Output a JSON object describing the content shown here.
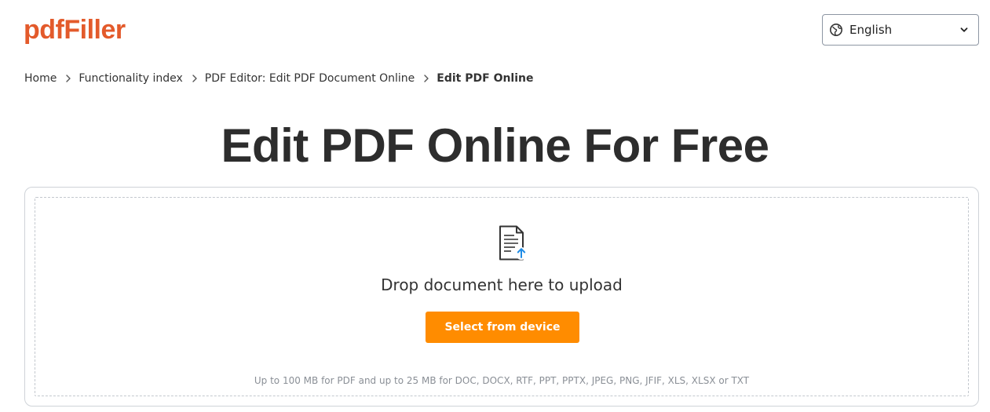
{
  "brand": {
    "logo_text": "pdfFiller",
    "accent_color": "#e35a2b"
  },
  "language": {
    "selected": "English",
    "icon": "globe-icon"
  },
  "breadcrumb": {
    "items": [
      "Home",
      "Functionality index",
      "PDF Editor: Edit PDF Document Online"
    ],
    "current": "Edit PDF Online"
  },
  "title": "Edit PDF Online For Free",
  "upload": {
    "icon": "document-upload-icon",
    "drop_text": "Drop document here to upload",
    "button_label": "Select from device",
    "button_color": "#ff8c00",
    "limits_text": "Up to 100 MB for PDF and up to 25 MB for DOC, DOCX, RTF, PPT, PPTX, JPEG, PNG, JFIF, XLS, XLSX or TXT"
  }
}
